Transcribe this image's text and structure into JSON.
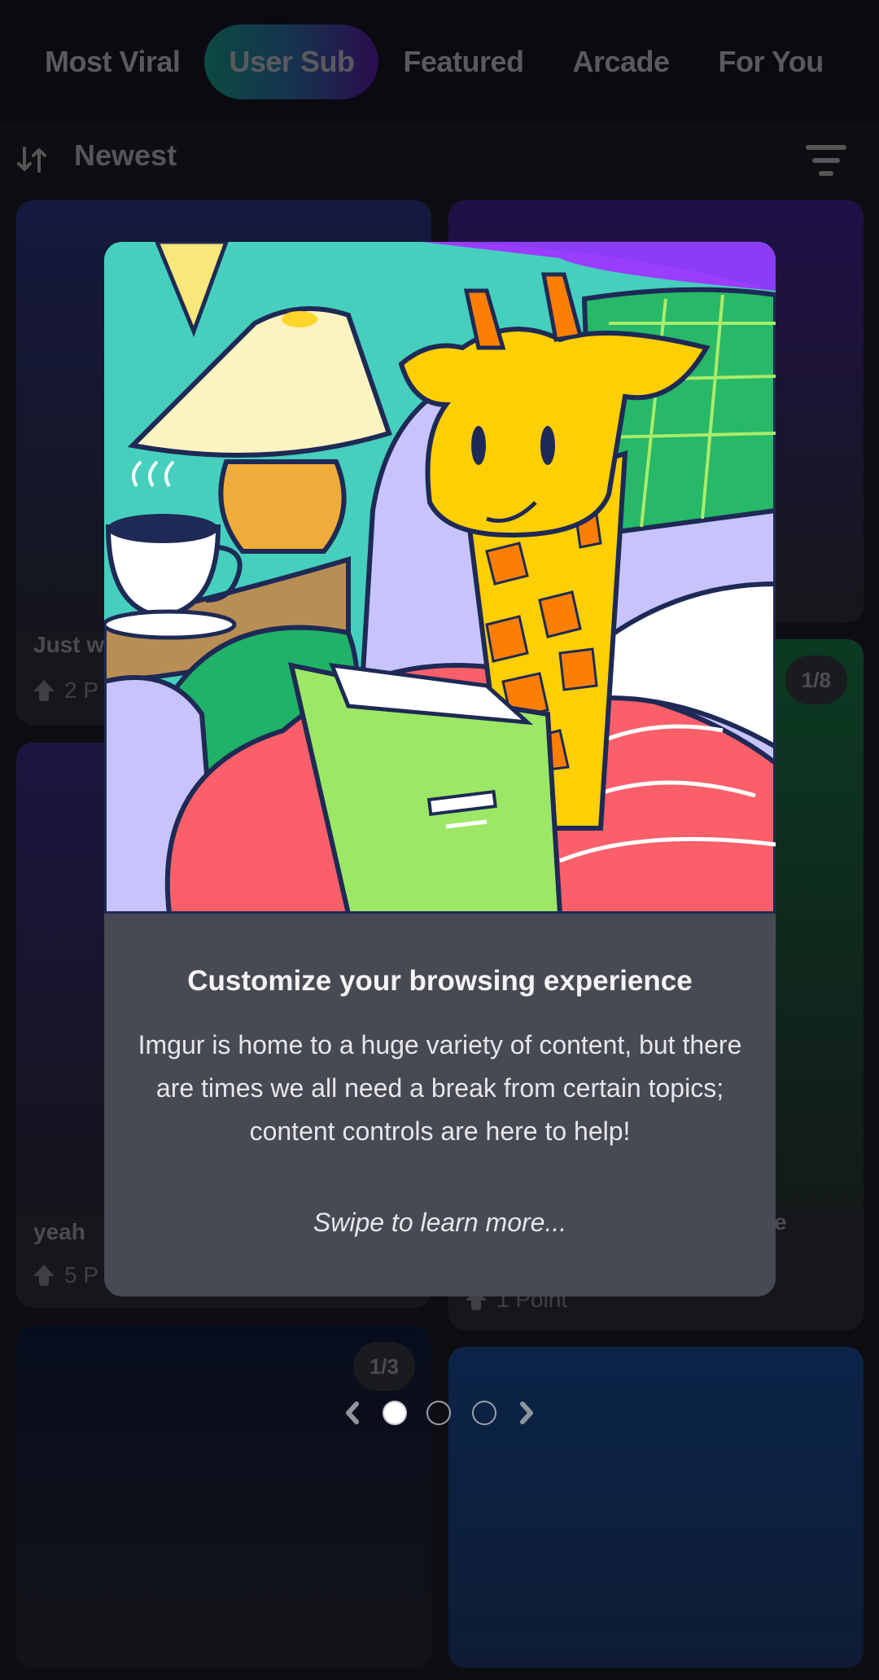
{
  "tabs": [
    {
      "label": "Most Viral",
      "active": false
    },
    {
      "label": "User Sub",
      "active": true
    },
    {
      "label": "Featured",
      "active": false
    },
    {
      "label": "Arcade",
      "active": false
    },
    {
      "label": "For You",
      "active": false
    }
  ],
  "sort": {
    "label": "Newest",
    "icon": "sort-arrows-icon"
  },
  "filter": {
    "icon": "filter-icon"
  },
  "feed": {
    "cards": [
      {
        "title": "Just w",
        "points": "2 P",
        "count": ""
      },
      {
        "title": "",
        "points": "",
        "count": ""
      },
      {
        "title": "yeah",
        "points": "5 P",
        "count": ""
      },
      {
        "title": "e",
        "points": "1 Point",
        "count": "1/8"
      },
      {
        "title": "",
        "points": "",
        "count": "1/3"
      },
      {
        "title": "",
        "points": "",
        "count": ""
      }
    ]
  },
  "modal": {
    "title": "Customize your browsing experience",
    "body": "Imgur is home to a huge variety of content, but there are times we all need a break from certain topics; content controls are here to help!",
    "hint": "Swipe to learn more...",
    "illustration": "giraffe-reading-book-illustration"
  },
  "pager": {
    "total": 3,
    "current": 1,
    "prev_icon": "chevron-left-icon",
    "next_icon": "chevron-right-icon"
  },
  "colors": {
    "active_tab_gradient": [
      "#0c4a42",
      "#2b0c4e"
    ],
    "modal_bg": "#474a52",
    "page_bg": "#0b0b0e"
  }
}
